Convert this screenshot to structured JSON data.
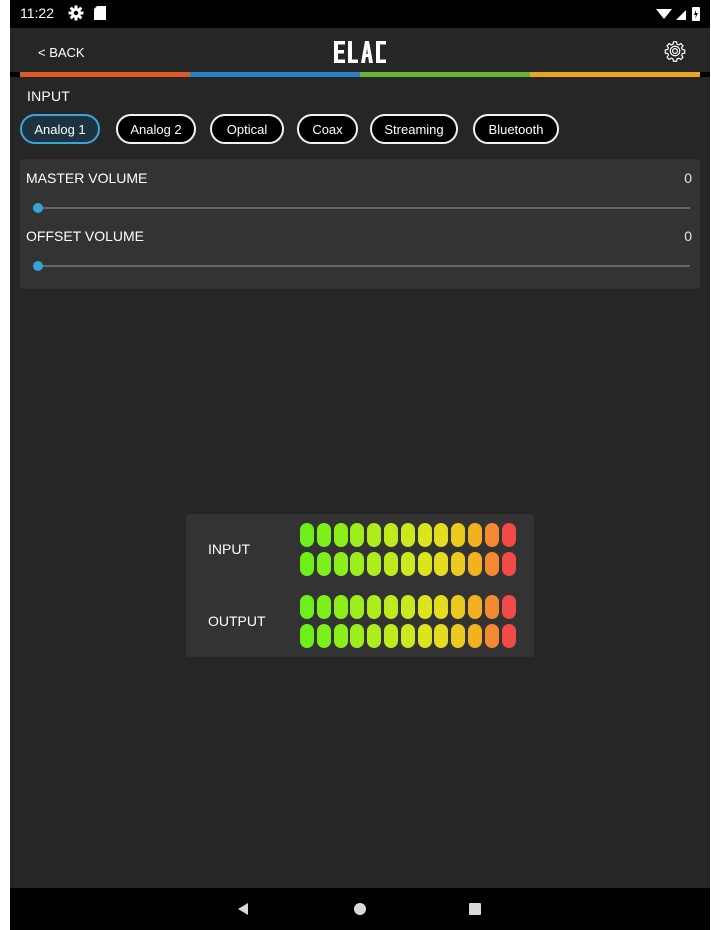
{
  "status_bar": {
    "time": "11:22",
    "icons": [
      "gear-icon",
      "sd-card-icon",
      "wifi-icon",
      "signal-icon",
      "battery-icon"
    ]
  },
  "app_bar": {
    "back_label": "< BACK",
    "logo_text": "ELAC",
    "settings_icon": "gear-icon"
  },
  "brand_colors": [
    "#e05a24",
    "#2a7fc7",
    "#6bb23a",
    "#e8a520"
  ],
  "input_section": {
    "title": "INPUT",
    "options": [
      "Analog 1",
      "Analog 2",
      "Optical",
      "Coax",
      "Streaming",
      "Bluetooth"
    ],
    "selected": "Analog 1",
    "accent": "#3aa5d8"
  },
  "volume": {
    "master_label": "MASTER VOLUME",
    "master_value": "0",
    "offset_label": "OFFSET VOLUME",
    "offset_value": "0",
    "slider_color": "#35a4dc",
    "master_level": 0,
    "offset_level": 0
  },
  "meters": {
    "input_label": "INPUT",
    "output_label": "OUTPUT",
    "segment_count": 13,
    "segment_colors": [
      "#6ef01a",
      "#7cf01a",
      "#8cef1b",
      "#9cee1c",
      "#aded1c",
      "#bdeb1d",
      "#cce81e",
      "#dae51e",
      "#e4dc1e",
      "#ecc91e",
      "#f2b11f",
      "#f38a2f",
      "#f14a47"
    ]
  },
  "nav_bar": {
    "icons": [
      "back-triangle-icon",
      "home-circle-icon",
      "recents-square-icon"
    ]
  }
}
